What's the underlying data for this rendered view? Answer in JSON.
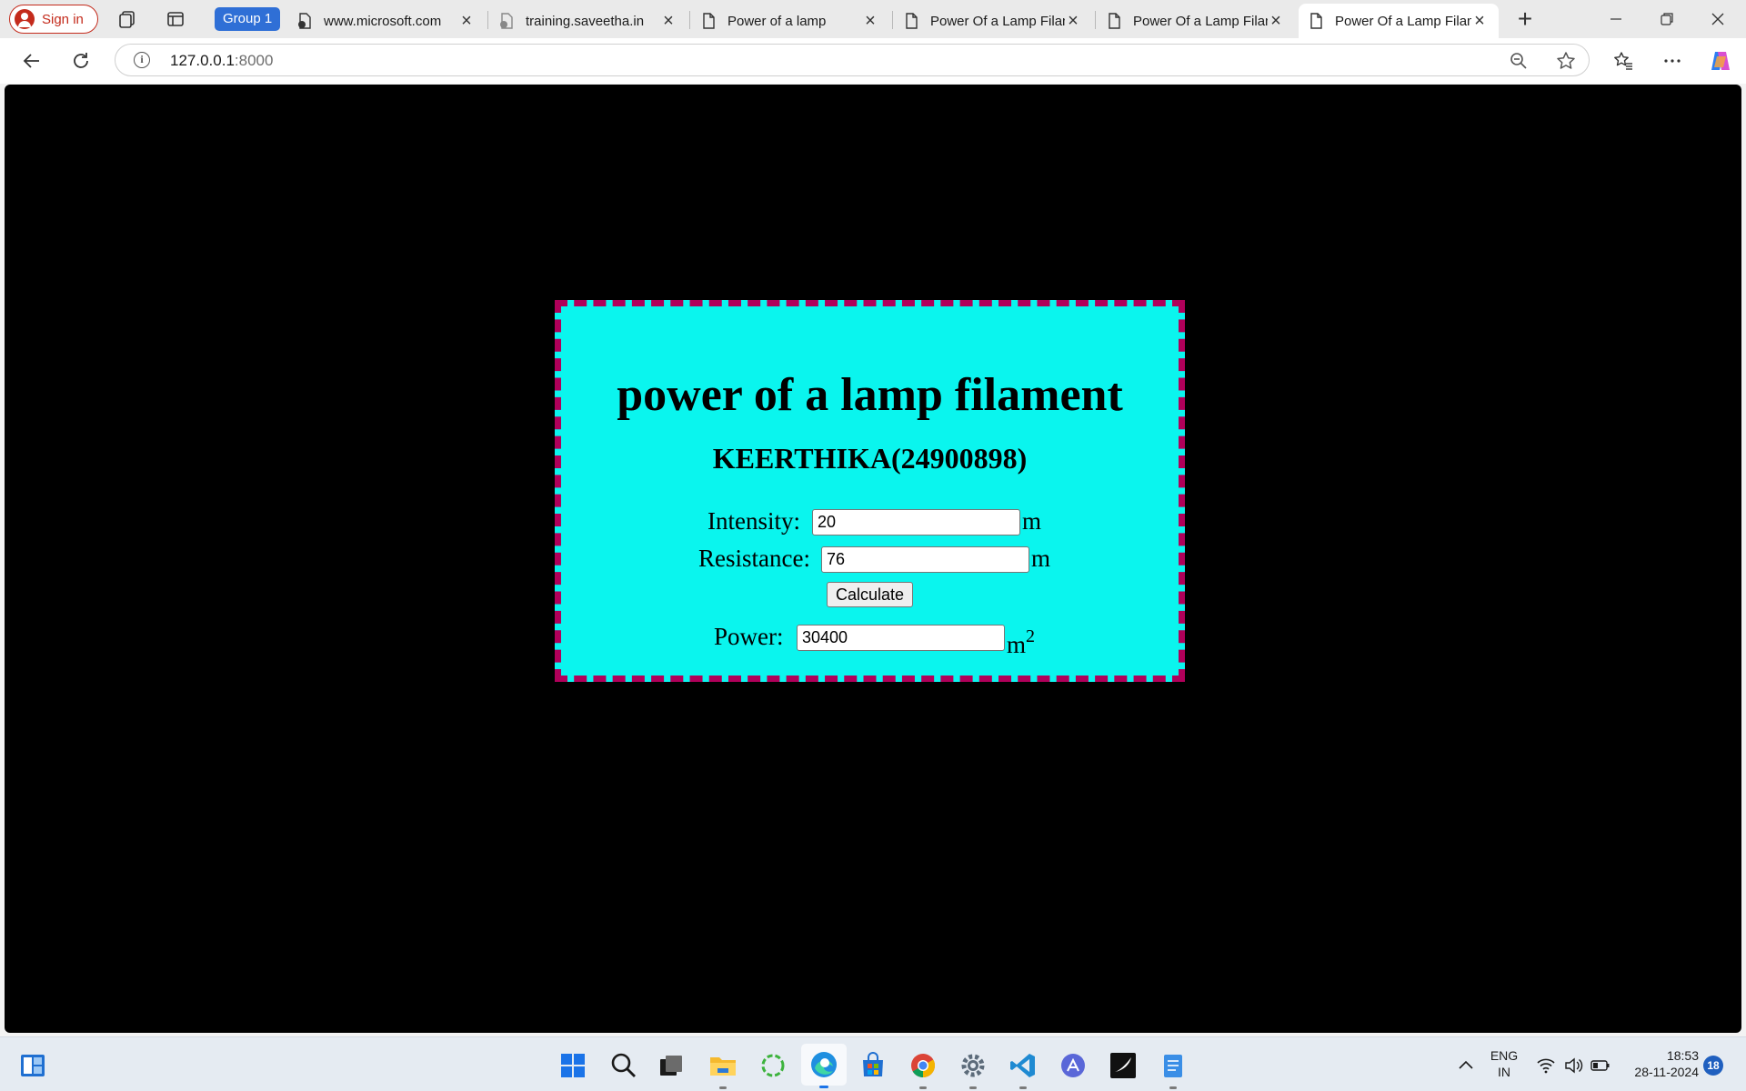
{
  "browser": {
    "signin_label": "Sign in",
    "group_label": "Group 1",
    "tabs": [
      {
        "title": "www.microsoft.com"
      },
      {
        "title": "training.saveetha.in"
      },
      {
        "title": "Power of a lamp"
      },
      {
        "title": "Power Of a Lamp Filament"
      },
      {
        "title": "Power Of a Lamp Filament"
      },
      {
        "title": "Power Of a Lamp Filament"
      }
    ],
    "address": {
      "host": "127.0.0.1",
      "port": ":8000"
    }
  },
  "page": {
    "title": "power of a lamp filament",
    "author": "KEERTHIKA(24900898)",
    "intensity": {
      "label": "Intensity:",
      "value": "20",
      "unit": "m"
    },
    "resistance": {
      "label": "Resistance:",
      "value": "76",
      "unit": "m"
    },
    "calculate_label": "Calculate",
    "power": {
      "label": "Power:",
      "value": "30400",
      "unit": "m",
      "unit_sup": "2"
    }
  },
  "taskbar": {
    "lang_line1": "ENG",
    "lang_line2": "IN",
    "time": "18:53",
    "date": "28-11-2024",
    "notification_count": "18"
  },
  "colors": {
    "card_background": "#0af5ee",
    "card_border": "#b0005a",
    "page_background": "#000000",
    "group_chip": "#2f6fd6",
    "signin_accent": "#c42b1c"
  }
}
